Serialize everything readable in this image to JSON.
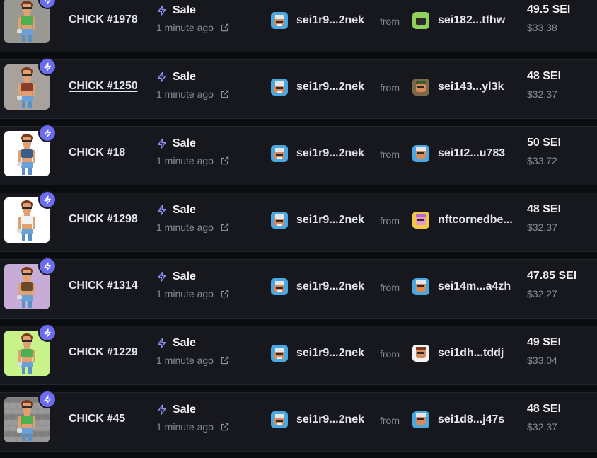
{
  "colors": {
    "accent": "#6b6cf0",
    "row_bg": "#17181d",
    "page_bg": "#0b0c10",
    "muted_text": "#8a8c96"
  },
  "rows": [
    {
      "name": "CHICK #1978",
      "event_type": "Sale",
      "time": "1 minute ago",
      "buyer": "sei1r9...2nek",
      "from_label": "from",
      "seller": "sei182...tfhw",
      "price_sei": "49.5 SEI",
      "price_usd": "$33.38",
      "thumb_bg": "#9a9893",
      "seller_avatar": "green",
      "underlined": false
    },
    {
      "name": "CHICK #1250",
      "event_type": "Sale",
      "time": "1 minute ago",
      "buyer": "sei1r9...2nek",
      "from_label": "from",
      "seller": "sei143...yl3k",
      "price_sei": "48 SEI",
      "price_usd": "$32.37",
      "thumb_bg": "#a8a29f",
      "seller_avatar": "camo",
      "underlined": true
    },
    {
      "name": "CHICK #18",
      "event_type": "Sale",
      "time": "1 minute ago",
      "buyer": "sei1r9...2nek",
      "from_label": "from",
      "seller": "sei1t2...u783",
      "price_sei": "50 SEI",
      "price_usd": "$33.72",
      "thumb_bg": "#ffffff",
      "seller_avatar": "blue",
      "underlined": false
    },
    {
      "name": "CHICK #1298",
      "event_type": "Sale",
      "time": "1 minute ago",
      "buyer": "sei1r9...2nek",
      "from_label": "from",
      "seller": "nftcornedbe...",
      "price_sei": "48 SEI",
      "price_usd": "$32.37",
      "thumb_bg": "#ffffff",
      "seller_avatar": "yellow",
      "underlined": false
    },
    {
      "name": "CHICK #1314",
      "event_type": "Sale",
      "time": "1 minute ago",
      "buyer": "sei1r9...2nek",
      "from_label": "from",
      "seller": "sei14m...a4zh",
      "price_sei": "47.85 SEI",
      "price_usd": "$32.27",
      "thumb_bg": "#c6acd6",
      "seller_avatar": "blue",
      "underlined": false
    },
    {
      "name": "CHICK #1229",
      "event_type": "Sale",
      "time": "1 minute ago",
      "buyer": "sei1r9...2nek",
      "from_label": "from",
      "seller": "sei1dh...tddj",
      "price_sei": "49 SEI",
      "price_usd": "$33.04",
      "thumb_bg": "#c8f28a",
      "seller_avatar": "brown",
      "underlined": false
    },
    {
      "name": "CHICK #45",
      "event_type": "Sale",
      "time": "1 minute ago",
      "buyer": "sei1r9...2nek",
      "from_label": "from",
      "seller": "sei1d8...j47s",
      "price_sei": "48 SEI",
      "price_usd": "$32.37",
      "thumb_bg": "#8c8c8c",
      "seller_avatar": "blue",
      "underlined": false
    }
  ]
}
